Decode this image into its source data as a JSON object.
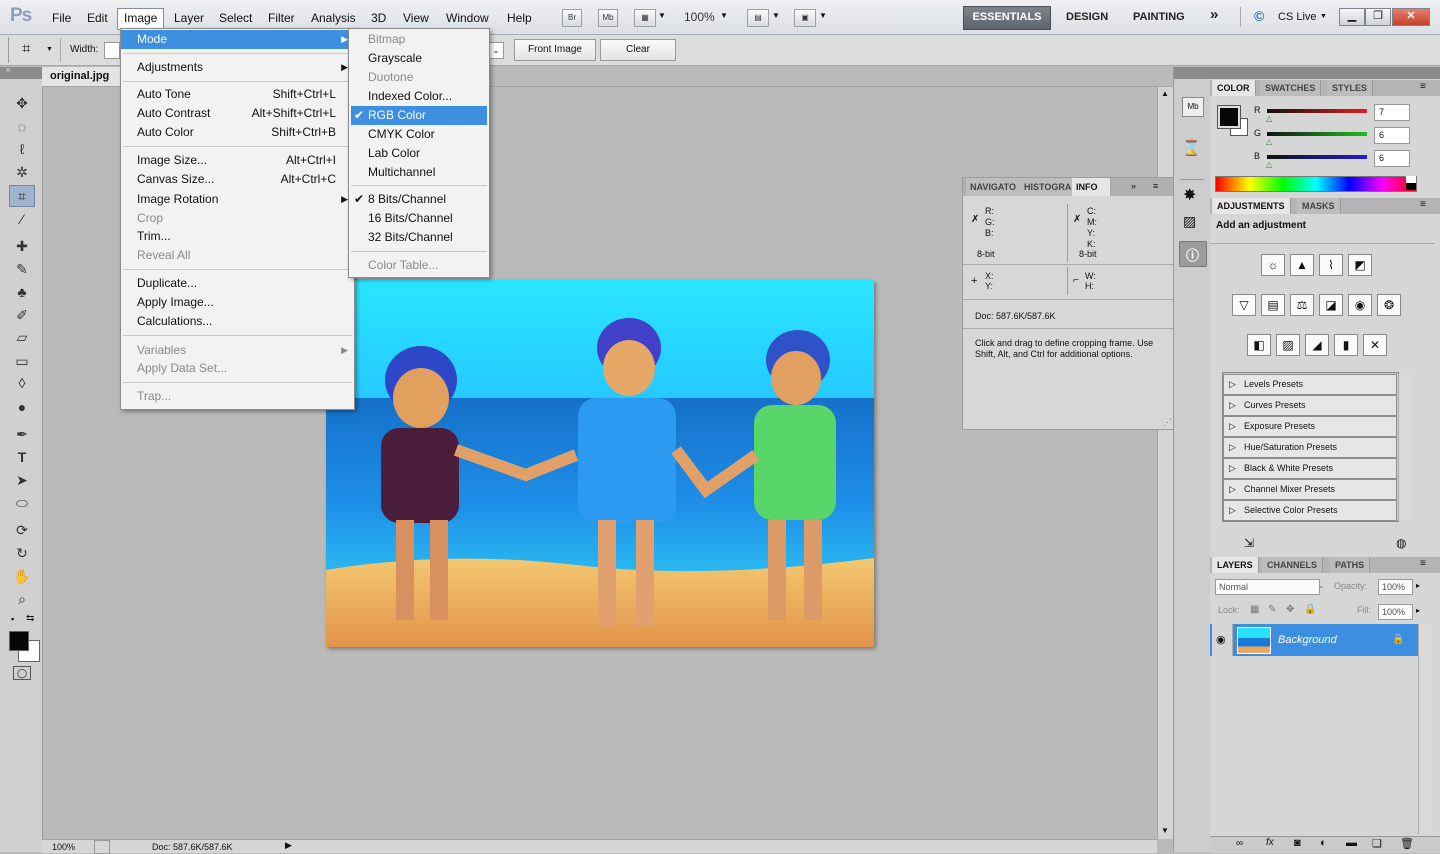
{
  "app": {
    "logo": "Ps",
    "menus": [
      "File",
      "Edit",
      "Image",
      "Layer",
      "Select",
      "Filter",
      "Analysis",
      "3D",
      "View",
      "Window",
      "Help"
    ],
    "active_menu": "Image",
    "toolbar_buttons": [
      "Br",
      "Mb"
    ],
    "zoom": "100%",
    "workspaces": [
      "ESSENTIALS",
      "DESIGN",
      "PAINTING"
    ],
    "more": "»",
    "cs_live": "CS Live"
  },
  "options_bar": {
    "width_label": "Width:",
    "front_image": "Front Image",
    "clear": "Clear"
  },
  "document": {
    "tab": "original.jpg",
    "status_zoom": "100%",
    "status_doc": "Doc: 587.6K/587.6K"
  },
  "image_menu": {
    "items": [
      {
        "label": "Mode",
        "shortcut": "",
        "state": "highlight",
        "submenu": true
      },
      {
        "label": "Adjustments",
        "shortcut": "",
        "state": "normal",
        "submenu": true
      },
      {
        "label": "Auto Tone",
        "shortcut": "Shift+Ctrl+L",
        "state": "normal"
      },
      {
        "label": "Auto Contrast",
        "shortcut": "Alt+Shift+Ctrl+L",
        "state": "normal"
      },
      {
        "label": "Auto Color",
        "shortcut": "Shift+Ctrl+B",
        "state": "normal"
      },
      {
        "label": "Image Size...",
        "shortcut": "Alt+Ctrl+I",
        "state": "normal"
      },
      {
        "label": "Canvas Size...",
        "shortcut": "Alt+Ctrl+C",
        "state": "normal"
      },
      {
        "label": "Image Rotation",
        "shortcut": "",
        "state": "normal",
        "submenu": true
      },
      {
        "label": "Crop",
        "shortcut": "",
        "state": "disabled"
      },
      {
        "label": "Trim...",
        "shortcut": "",
        "state": "normal"
      },
      {
        "label": "Reveal All",
        "shortcut": "",
        "state": "disabled"
      },
      {
        "label": "Duplicate...",
        "shortcut": "",
        "state": "normal"
      },
      {
        "label": "Apply Image...",
        "shortcut": "",
        "state": "normal"
      },
      {
        "label": "Calculations...",
        "shortcut": "",
        "state": "normal"
      },
      {
        "label": "Variables",
        "shortcut": "",
        "state": "disabled",
        "submenu": true
      },
      {
        "label": "Apply Data Set...",
        "shortcut": "",
        "state": "disabled"
      },
      {
        "label": "Trap...",
        "shortcut": "",
        "state": "disabled"
      }
    ]
  },
  "mode_menu": {
    "items": [
      {
        "label": "Bitmap",
        "state": "disabled",
        "checked": false
      },
      {
        "label": "Grayscale",
        "state": "normal",
        "checked": false
      },
      {
        "label": "Duotone",
        "state": "disabled",
        "checked": false
      },
      {
        "label": "Indexed Color...",
        "state": "normal",
        "checked": false
      },
      {
        "label": "RGB Color",
        "state": "highlight",
        "checked": true
      },
      {
        "label": "CMYK Color",
        "state": "normal",
        "checked": false
      },
      {
        "label": "Lab Color",
        "state": "normal",
        "checked": false
      },
      {
        "label": "Multichannel",
        "state": "normal",
        "checked": false
      },
      {
        "label": "8 Bits/Channel",
        "state": "normal",
        "checked": true
      },
      {
        "label": "16 Bits/Channel",
        "state": "normal",
        "checked": false
      },
      {
        "label": "32 Bits/Channel",
        "state": "normal",
        "checked": false
      },
      {
        "label": "Color Table...",
        "state": "disabled",
        "checked": false
      }
    ]
  },
  "info_panel": {
    "tabs": [
      "NAVIGATO",
      "HISTOGRA",
      "INFO"
    ],
    "active_tab": "INFO",
    "rgb_labels": [
      "R:",
      "G:",
      "B:"
    ],
    "cmyk_labels": [
      "C:",
      "M:",
      "Y:",
      "K:"
    ],
    "bit_left": "8-bit",
    "bit_right": "8-bit",
    "xy": [
      "X:",
      "Y:"
    ],
    "wh": [
      "W:",
      "H:"
    ],
    "doc": "Doc: 587.6K/587.6K",
    "hint": "Click and drag to define cropping frame. Use Shift, Alt, and Ctrl for additional options."
  },
  "color_panel": {
    "tabs": [
      "COLOR",
      "SWATCHES",
      "STYLES"
    ],
    "channels": [
      {
        "name": "R",
        "value": "7",
        "color": "#e02020"
      },
      {
        "name": "G",
        "value": "6",
        "color": "#20c020"
      },
      {
        "name": "B",
        "value": "6",
        "color": "#2020d0"
      }
    ]
  },
  "adjustments_panel": {
    "tabs": [
      "ADJUSTMENTS",
      "MASKS"
    ],
    "title": "Add an adjustment",
    "presets": [
      "Levels Presets",
      "Curves Presets",
      "Exposure Presets",
      "Hue/Saturation Presets",
      "Black & White Presets",
      "Channel Mixer Presets",
      "Selective Color Presets"
    ]
  },
  "layers_panel": {
    "tabs": [
      "LAYERS",
      "CHANNELS",
      "PATHS"
    ],
    "blend_mode": "Normal",
    "opacity_label": "Opacity:",
    "opacity": "100%",
    "lock_label": "Lock:",
    "fill_label": "Fill:",
    "fill": "100%",
    "layer_name": "Background"
  }
}
